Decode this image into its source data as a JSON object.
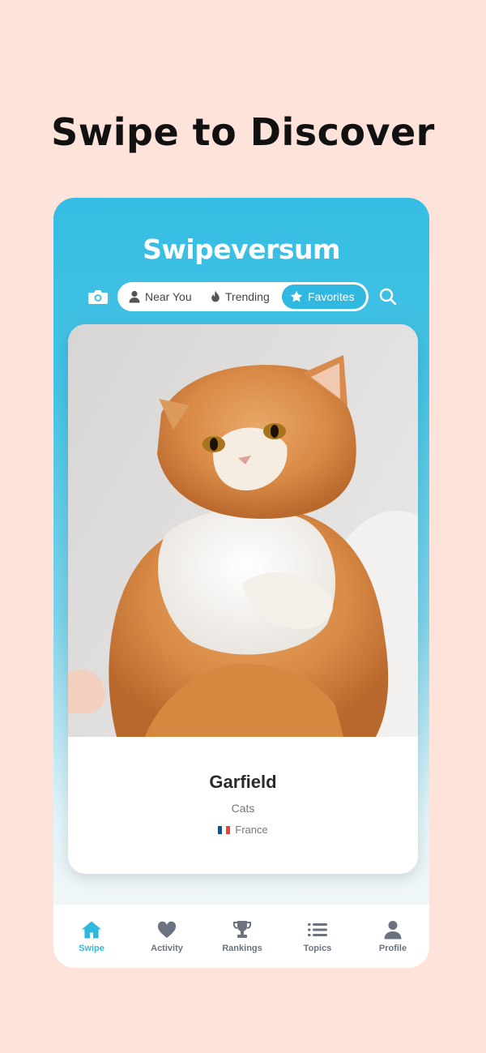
{
  "headline": "Swipe to Discover",
  "app": {
    "title": "Swipeversum"
  },
  "header": {
    "camera_icon": "camera-icon",
    "search_icon": "search-icon",
    "segments": [
      {
        "label": "Near You",
        "icon": "person-icon",
        "active": false
      },
      {
        "label": "Trending",
        "icon": "flame-icon",
        "active": false
      },
      {
        "label": "Favorites",
        "icon": "star-icon",
        "active": true
      }
    ]
  },
  "card": {
    "name": "Garfield",
    "category": "Cats",
    "country": "France",
    "flag_icon": "france-flag-icon"
  },
  "tabbar": {
    "items": [
      {
        "label": "Swipe",
        "icon": "home-icon",
        "active": true
      },
      {
        "label": "Activity",
        "icon": "heart-icon",
        "active": false
      },
      {
        "label": "Rankings",
        "icon": "trophy-icon",
        "active": false
      },
      {
        "label": "Topics",
        "icon": "list-icon",
        "active": false
      },
      {
        "label": "Profile",
        "icon": "user-icon",
        "active": false
      }
    ]
  },
  "colors": {
    "accent": "#2fb9e0",
    "background": "#fde3da",
    "header_top": "#36bde3",
    "inactive": "#6b7280"
  }
}
